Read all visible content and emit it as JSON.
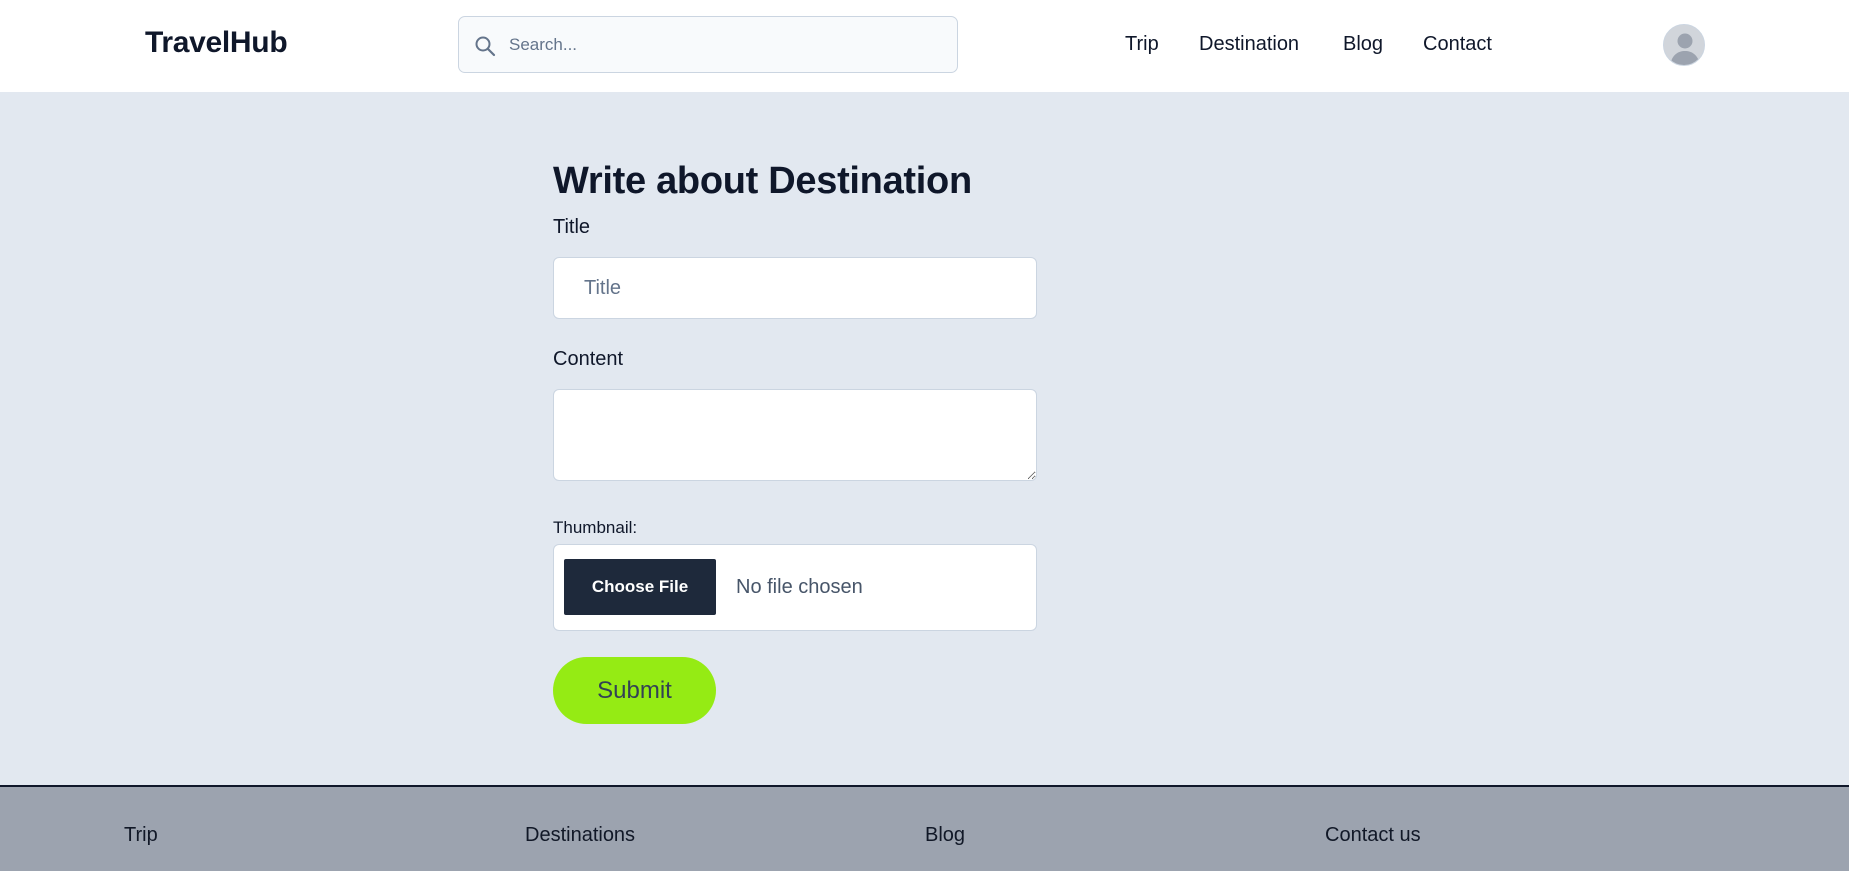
{
  "header": {
    "logo": "TravelHub",
    "search_placeholder": "Search...",
    "nav": [
      "Trip",
      "Destination",
      "Blog",
      "Contact"
    ]
  },
  "form": {
    "heading": "Write about Destination",
    "title_label": "Title",
    "title_placeholder": "Title",
    "content_label": "Content",
    "thumbnail_label": "Thumbnail:",
    "file_button": "Choose File",
    "file_status": "No file chosen",
    "submit_label": "Submit"
  },
  "footer": {
    "links": [
      "Trip",
      "Destinations",
      "Blog",
      "Contact us"
    ]
  },
  "colors": {
    "accent": "#95eb14",
    "page_bg": "#e2e8f0",
    "footer_bg": "#9ca3af",
    "dark_button": "#1e293b"
  }
}
